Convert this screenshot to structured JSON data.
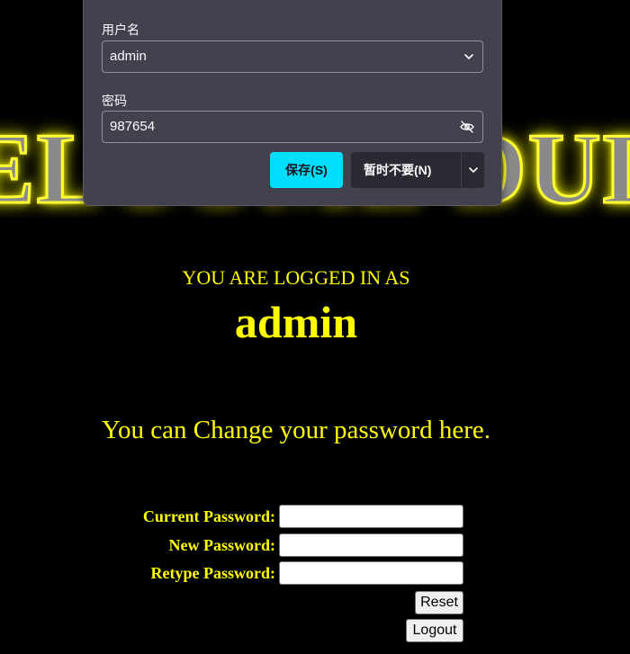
{
  "banner": {
    "text": "WELCOME DUDE"
  },
  "popup": {
    "username_label": "用户名",
    "username_value": "admin",
    "password_label": "密码",
    "password_value": "987654",
    "save_label": "保存(S)",
    "not_now_label": "暂时不要(N)",
    "accent_color": "#00ddff"
  },
  "main": {
    "logged_in_as": "YOU ARE LOGGED IN AS",
    "username": "admin",
    "change_message": "You can Change your password here.",
    "text_color": "#ffff00"
  },
  "form": {
    "current_label": "Current Password:",
    "new_label": "New Password:",
    "retype_label": "Retype Password:",
    "reset_label": "Reset",
    "logout_label": "Logout"
  }
}
